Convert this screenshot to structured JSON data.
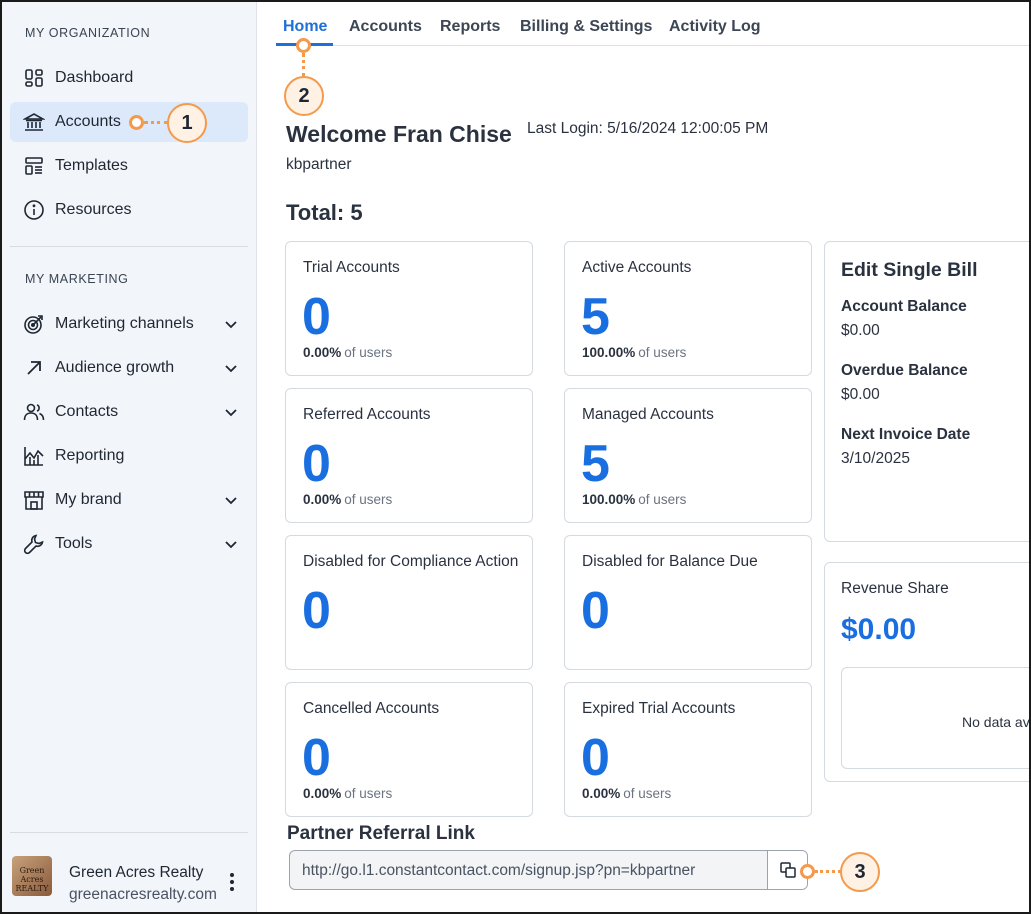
{
  "sidebar": {
    "org_section": "MY ORGANIZATION",
    "marketing_section": "MY MARKETING",
    "org_items": [
      {
        "label": "Dashboard",
        "icon": "dashboard-icon"
      },
      {
        "label": "Accounts",
        "icon": "bank-icon",
        "active": true
      },
      {
        "label": "Templates",
        "icon": "templates-icon"
      },
      {
        "label": "Resources",
        "icon": "info-icon"
      }
    ],
    "marketing_items": [
      {
        "label": "Marketing channels",
        "icon": "target-icon",
        "expandable": true
      },
      {
        "label": "Audience growth",
        "icon": "arrow-up-right-icon",
        "expandable": true
      },
      {
        "label": "Contacts",
        "icon": "contacts-icon",
        "expandable": true
      },
      {
        "label": "Reporting",
        "icon": "chart-icon",
        "expandable": false
      },
      {
        "label": "My brand",
        "icon": "storefront-icon",
        "expandable": true
      },
      {
        "label": "Tools",
        "icon": "wrench-icon",
        "expandable": true
      }
    ],
    "account": {
      "name": "Green Acres Realty",
      "site": "greenacresrealty.com",
      "logo_text": "Green Acres REALTY"
    }
  },
  "tabs": [
    {
      "label": "Home",
      "active": true
    },
    {
      "label": "Accounts"
    },
    {
      "label": "Reports"
    },
    {
      "label": "Billing & Settings"
    },
    {
      "label": "Activity Log"
    }
  ],
  "header": {
    "welcome": "Welcome Fran Chise",
    "last_login": "Last Login: 5/16/2024 12:00:05 PM",
    "username": "kbpartner",
    "total": "Total: 5"
  },
  "cards": [
    {
      "title": "Trial Accounts",
      "value": "0",
      "pct": "0.00%",
      "pct_suffix": "of users"
    },
    {
      "title": "Active Accounts",
      "value": "5",
      "pct": "100.00%",
      "pct_suffix": "of users"
    },
    {
      "title": "Referred Accounts",
      "value": "0",
      "pct": "0.00%",
      "pct_suffix": "of users"
    },
    {
      "title": "Managed Accounts",
      "value": "5",
      "pct": "100.00%",
      "pct_suffix": "of users"
    },
    {
      "title": "Disabled for Compliance Action",
      "value": "0"
    },
    {
      "title": "Disabled for Balance Due",
      "value": "0"
    },
    {
      "title": "Cancelled Accounts",
      "value": "0",
      "pct": "0.00%",
      "pct_suffix": "of users"
    },
    {
      "title": "Expired Trial Accounts",
      "value": "0",
      "pct": "0.00%",
      "pct_suffix": "of users"
    }
  ],
  "billing": {
    "title": "Edit Single Bill",
    "account_balance_label": "Account Balance",
    "account_balance": "$0.00",
    "overdue_label": "Overdue Balance",
    "overdue": "$0.00",
    "invoice_label": "Next Invoice Date",
    "invoice_date": "3/10/2025"
  },
  "revenue": {
    "title": "Revenue Share",
    "value": "$0.00",
    "empty_text": "No data available"
  },
  "referral": {
    "label": "Partner Referral Link",
    "url": "http://go.l1.constantcontact.com/signup.jsp?pn=kbpartner"
  },
  "callouts": [
    "1",
    "2",
    "3"
  ],
  "colors": {
    "accent": "#1f6fd8",
    "value_blue": "#1a6fe0",
    "active_nav_bg": "#dbe9fa",
    "callout_orange": "#f39a4c"
  }
}
